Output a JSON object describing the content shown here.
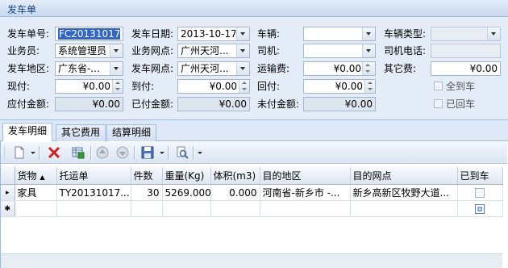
{
  "header": {
    "title": "发车单"
  },
  "form": {
    "dispatch_no": {
      "label": "发车单号:",
      "value": "FC20131017"
    },
    "dispatch_date": {
      "label": "发车日期:",
      "value": "2013-10-17"
    },
    "vehicle": {
      "label": "车辆:",
      "value": ""
    },
    "vehicle_type": {
      "label": "车辆类型:",
      "value": ""
    },
    "salesman": {
      "label": "业务员:",
      "value": "系统管理员"
    },
    "business_outlet": {
      "label": "业务网点:",
      "value": "广州天河..."
    },
    "driver": {
      "label": "司机:",
      "value": ""
    },
    "driver_phone": {
      "label": "司机电话:",
      "value": ""
    },
    "origin_area": {
      "label": "发车地区:",
      "value": "广东省-..."
    },
    "origin_outlet": {
      "label": "发车网点:",
      "value": "广州天河..."
    },
    "freight": {
      "label": "运输费:",
      "value": "¥0.00"
    },
    "other_fee": {
      "label": "其它费:",
      "value": "¥0.00"
    },
    "cash_pay": {
      "label": "现付:",
      "value": "¥0.00"
    },
    "arrival_pay": {
      "label": "到付:",
      "value": "¥0.00"
    },
    "return_pay": {
      "label": "回付:",
      "value": "¥0.00"
    },
    "all_arrived": {
      "label": "全到车"
    },
    "payable_total": {
      "label": "应付金额:",
      "value": "¥0.00"
    },
    "paid_total": {
      "label": "已付金额:",
      "value": "¥0.00"
    },
    "unpaid_total": {
      "label": "未付金额:",
      "value": "¥0.00"
    },
    "returned": {
      "label": "已回车"
    }
  },
  "tabs": [
    {
      "label": "发车明细"
    },
    {
      "label": "其它费用"
    },
    {
      "label": "结算明细"
    }
  ],
  "toolbar": {
    "icons": [
      "new-icon",
      "delete-icon",
      "save-grid-icon",
      "move-up-icon",
      "move-down-icon",
      "save-icon",
      "search-icon"
    ]
  },
  "grid": {
    "columns": [
      "货物",
      "托运单",
      "件数",
      "重量(Kg)",
      "体积(m3)",
      "目的地区",
      "目的网点",
      "已到车"
    ],
    "rows": [
      {
        "indicator": "▸",
        "goods": "家具",
        "waybill": "TY20131017...",
        "pieces": "30",
        "weight": "5269.000",
        "volume": "0.000",
        "dest_area": "河南省-新乡市 -...",
        "dest_outlet": "新乡高新区牧野大道...",
        "arrived": false
      }
    ],
    "new_row_indicator": "✱"
  },
  "colors": {
    "accent": "#15428b",
    "panel": "#e3ecf7",
    "border": "#99bbe8"
  }
}
